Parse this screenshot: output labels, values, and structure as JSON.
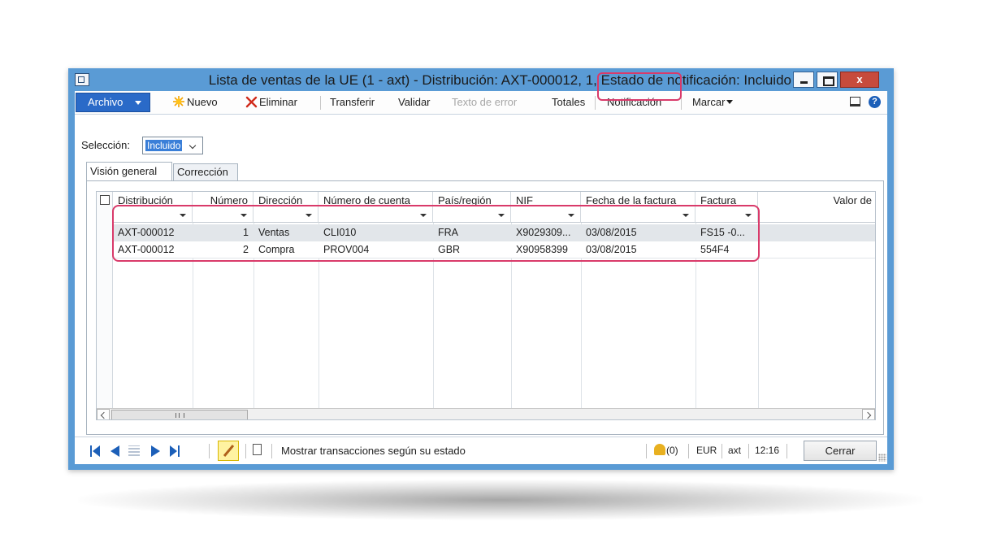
{
  "window": {
    "title": "Lista de ventas de la UE (1 - axt) - Distribución: AXT-000012, 1, Estado de notificación: Incluido",
    "close_glyph": "x"
  },
  "menubar": {
    "archivo": "Archivo",
    "nuevo": "Nuevo",
    "eliminar": "Eliminar",
    "transferir": "Transferir",
    "validar": "Validar",
    "texto_error": "Texto de error",
    "totales": "Totales",
    "notificacion": "Notificación",
    "marcar": "Marcar",
    "help_glyph": "?"
  },
  "selection": {
    "label": "Selección:",
    "value": "Incluido"
  },
  "tabs": [
    {
      "label": "Visión general",
      "active": true
    },
    {
      "label": "Corrección",
      "active": false
    }
  ],
  "grid": {
    "columns": [
      "Distribución",
      "Número",
      "Dirección",
      "Número de cuenta",
      "País/región",
      "NIF",
      "Fecha de la factura",
      "Factura",
      "Valor de"
    ],
    "rows": [
      {
        "distribucion": "AXT-000012",
        "numero": "1",
        "direccion": "Ventas",
        "cuenta": "CLI010",
        "pais": "FRA",
        "nif": "X9029309...",
        "fecha": "03/08/2015",
        "factura": "FS15 -0...",
        "valor": ""
      },
      {
        "distribucion": "AXT-000012",
        "numero": "2",
        "direccion": "Compra",
        "cuenta": "PROV004",
        "pais": "GBR",
        "nif": "X90958399",
        "fecha": "03/08/2015",
        "factura": "554F4",
        "valor": ""
      }
    ]
  },
  "status": {
    "message": "Mostrar transacciones según su estado",
    "notifications": "(0)",
    "currency": "EUR",
    "company": "axt",
    "time": "12:16",
    "close_button": "Cerrar"
  },
  "colors": {
    "window_frame": "#5a9bd5",
    "archivo_button": "#2a6ac8",
    "highlight": "#d93a6a",
    "nav_blue": "#1c5fb8"
  }
}
